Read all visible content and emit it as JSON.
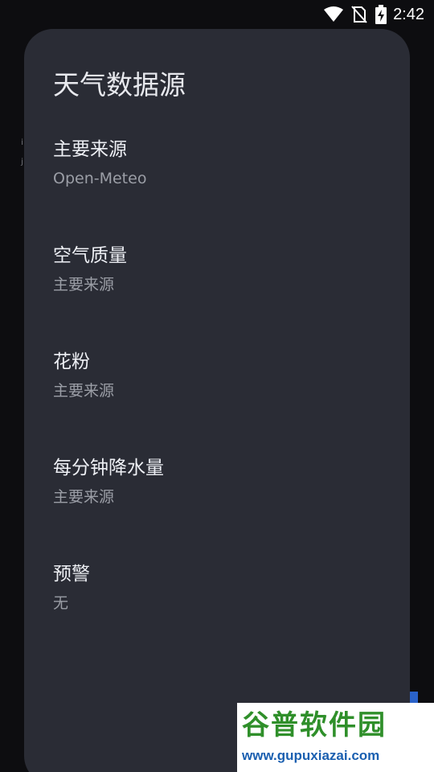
{
  "status_bar": {
    "time": "2:42",
    "icons": [
      "wifi-icon",
      "no-sim-icon",
      "battery-charging-icon"
    ]
  },
  "background": {
    "hint_line1": "ᵢ",
    "hint_line2": "ʲ"
  },
  "dialog": {
    "title": "天气数据源",
    "items": [
      {
        "title": "主要来源",
        "summary": "Open-Meteo"
      },
      {
        "title": "空气质量",
        "summary": "主要来源"
      },
      {
        "title": "花粉",
        "summary": "主要来源"
      },
      {
        "title": "每分钟降水量",
        "summary": "主要来源"
      },
      {
        "title": "预警",
        "summary": "无"
      }
    ]
  },
  "watermark": {
    "brand": "谷普软件园",
    "url": "www.gupuxiazai.com"
  }
}
